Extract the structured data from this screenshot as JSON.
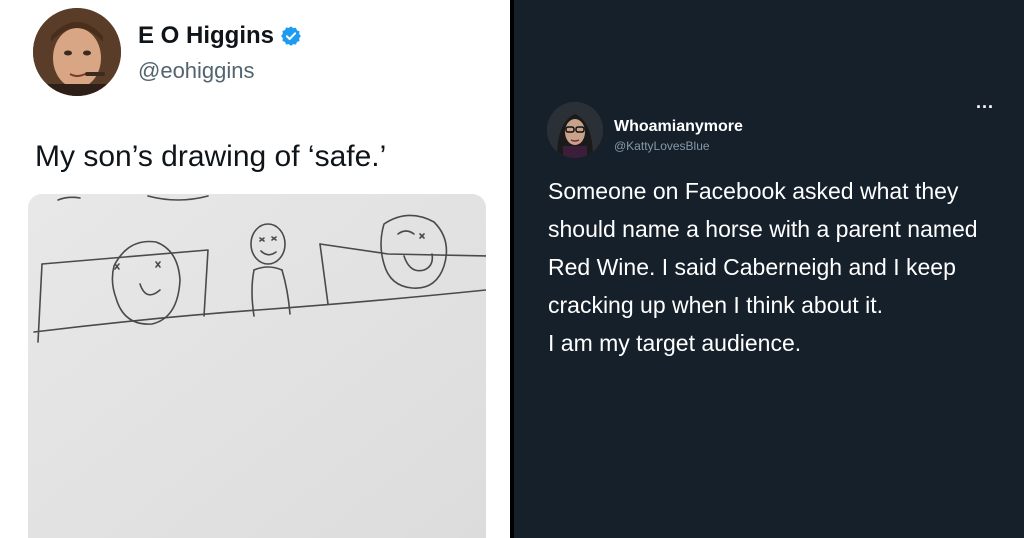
{
  "left_tweet": {
    "display_name": "E O Higgins",
    "handle": "@eohiggins",
    "text": "My son’s drawing of ‘safe.’",
    "icons": {
      "verified": "verified-badge-icon",
      "avatar": "avatar"
    },
    "colors": {
      "verified": "#1d9bf0",
      "name": "#0f1419",
      "handle": "#536471",
      "background": "#ffffff"
    }
  },
  "right_tweet": {
    "display_name": "Whoamianymore",
    "handle": "@KattyLovesBlue",
    "more": "...",
    "lines": [
      "Someone on Facebook asked what they should name a horse with a parent named Red Wine. I said Caberneigh and I keep cracking up when I think about it.",
      "I am my target audience."
    ],
    "icons": {
      "more": "more-options-icon",
      "avatar": "avatar"
    },
    "colors": {
      "background": "#15202b",
      "text": "#ffffff",
      "handle": "#8899a6"
    }
  }
}
